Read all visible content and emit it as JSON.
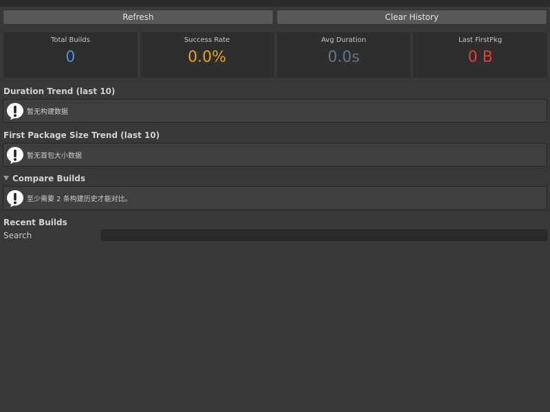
{
  "toolbar": {
    "refresh_label": "Refresh",
    "clear_label": "Clear History"
  },
  "stats": [
    {
      "label": "Total Builds",
      "value": "0",
      "color": "#4a8fe0"
    },
    {
      "label": "Success Rate",
      "value": "0.0%",
      "color": "#e8a21d"
    },
    {
      "label": "Avg Duration",
      "value": "0.0s",
      "color": "#5e7a88"
    },
    {
      "label": "Last FirstPkg",
      "value": "0 B",
      "color": "#e04040"
    }
  ],
  "duration_trend": {
    "title": "Duration Trend (last 10)",
    "message": "暂无构建数据"
  },
  "package_trend": {
    "title": "First Package Size Trend (last 10)",
    "message": "暂无首包大小数据"
  },
  "compare": {
    "title": "Compare Builds",
    "message": "至少需要 2 条构建历史才能对比。"
  },
  "recent": {
    "title": "Recent Builds",
    "search_label": "Search",
    "search_value": ""
  },
  "icons": {
    "info": "warning-speech-bubble-icon",
    "foldout": "triangle-down-icon"
  }
}
